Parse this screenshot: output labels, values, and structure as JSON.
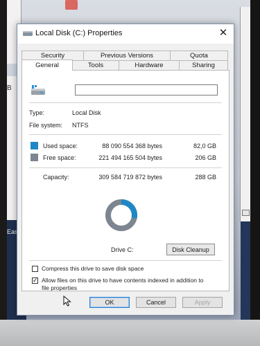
{
  "background": {
    "left_fragment_letter": "B",
    "left_fragment_text": "Easy"
  },
  "dialog": {
    "title": "Local Disk (C:) Properties",
    "close_glyph": "✕",
    "tabs_row1": [
      {
        "label": "Security"
      },
      {
        "label": "Previous Versions"
      },
      {
        "label": "Quota"
      }
    ],
    "tabs_row2": [
      {
        "label": "General",
        "active": true
      },
      {
        "label": "Tools"
      },
      {
        "label": "Hardware"
      },
      {
        "label": "Sharing"
      }
    ],
    "general": {
      "name_value": "",
      "type_label": "Type:",
      "type_value": "Local Disk",
      "fs_label": "File system:",
      "fs_value": "NTFS",
      "used_label": "Used space:",
      "used_bytes": "88 090 554 368 bytes",
      "used_size": "82,0 GB",
      "free_label": "Free space:",
      "free_bytes": "221 494 165 504 bytes",
      "free_size": "206 GB",
      "capacity_label": "Capacity:",
      "capacity_bytes": "309 584 719 872 bytes",
      "capacity_size": "288 GB",
      "drive_caption": "Drive C:",
      "cleanup_label": "Disk Cleanup",
      "used_fraction": 0.2846,
      "compress_label": "Compress this drive to save disk space",
      "compress_checked": false,
      "index_label_line1": "Allow files on this drive to have contents indexed in addition to",
      "index_label_line2": "file properties",
      "index_checked": true
    },
    "buttons": {
      "ok": "OK",
      "cancel": "Cancel",
      "apply": "Apply"
    }
  },
  "colors": {
    "used": "#1f88c4",
    "free": "#7d8590"
  },
  "icons": [
    "drive-icon",
    "close-icon",
    "checkmark-icon",
    "mouse-cursor-icon"
  ]
}
